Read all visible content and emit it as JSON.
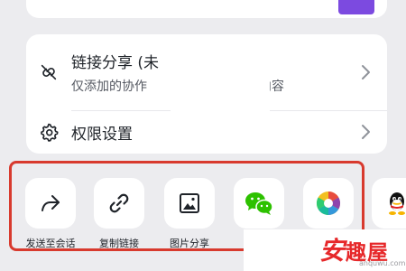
{
  "share_options": {
    "link_share": {
      "title": "链接分享 (未",
      "subtitle": "仅添加的协作",
      "subtitle_end": "打开内容",
      "icon": "link-off-icon"
    },
    "permissions": {
      "title": "权限设置",
      "icon": "gear-icon"
    }
  },
  "share_actions": [
    {
      "label": "发送至会话",
      "icon": "forward-arrow-icon"
    },
    {
      "label": "复制链接",
      "icon": "link-icon"
    },
    {
      "label": "图片分享",
      "icon": "image-icon"
    },
    {
      "label": "",
      "icon": "wechat-icon"
    },
    {
      "label": "",
      "icon": "moments-icon"
    },
    {
      "label": "",
      "icon": "qq-icon"
    }
  ],
  "watermark": {
    "text_first": "安",
    "text_rest": "趣屋",
    "domain": "anquwu.com"
  },
  "colors": {
    "highlight": "#d83a2e",
    "accent": "#7c4ae0",
    "wechat_green": "#2dc100",
    "watermark_red": "#e6282a"
  }
}
